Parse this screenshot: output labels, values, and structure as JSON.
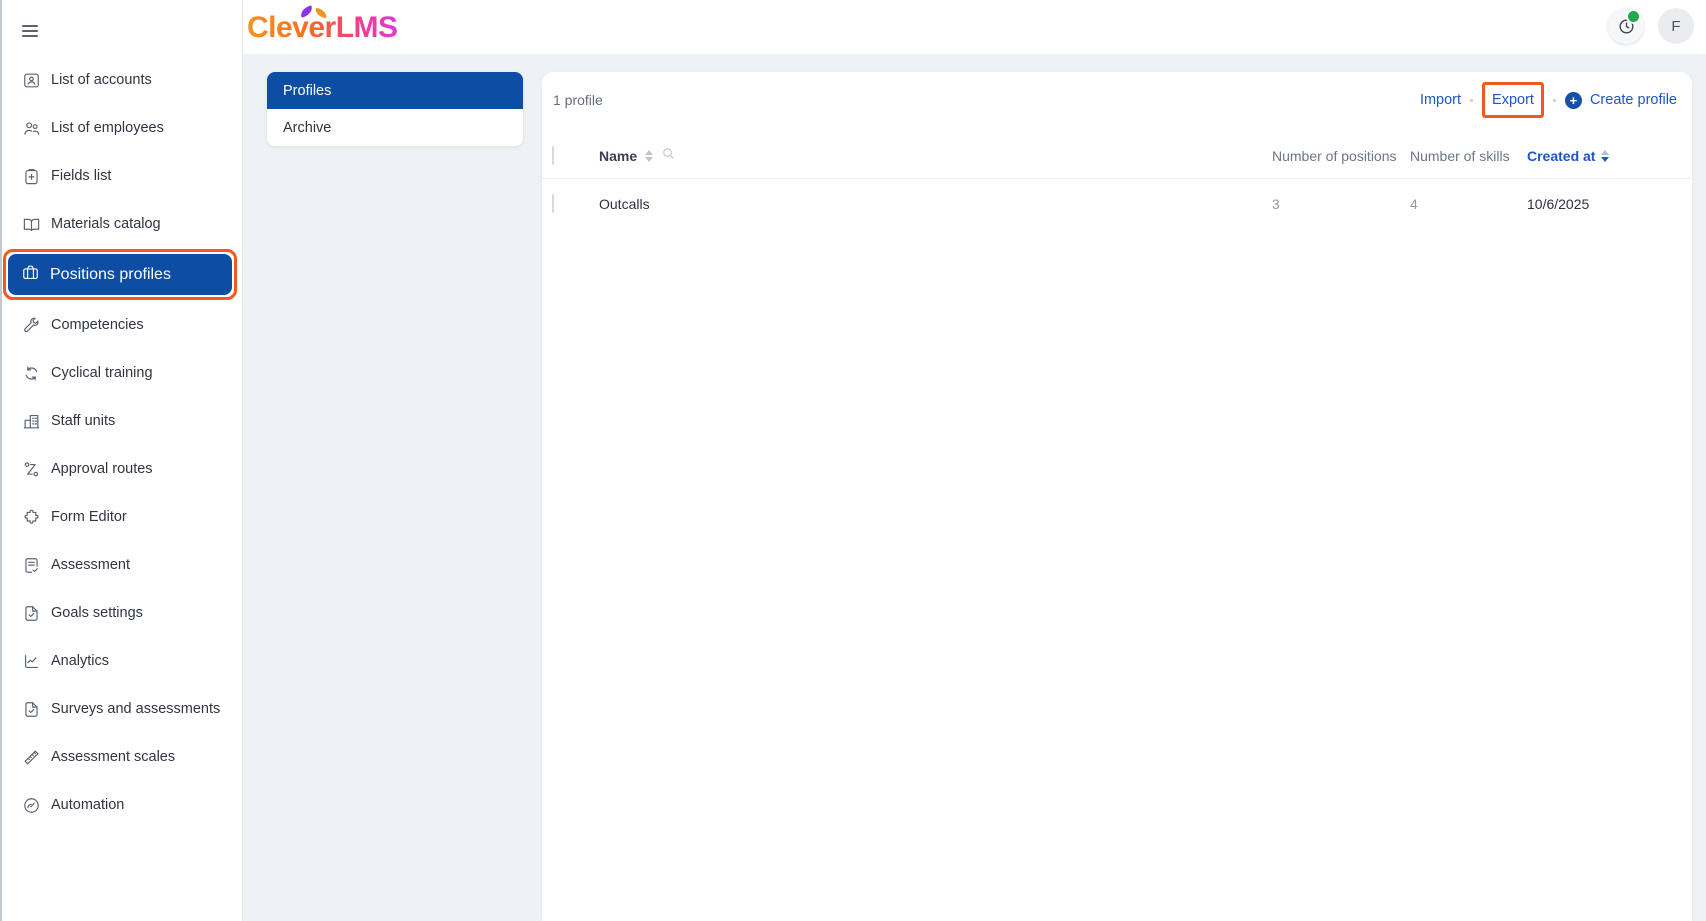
{
  "header": {
    "logo_text": "CleverLMS",
    "avatar_initial": "F"
  },
  "sidebar": {
    "items": [
      {
        "label": "List of accounts",
        "icon": "account-card-icon"
      },
      {
        "label": "List of employees",
        "icon": "people-icon"
      },
      {
        "label": "Fields list",
        "icon": "clipboard-plus-icon"
      },
      {
        "label": "Materials catalog",
        "icon": "open-book-icon"
      },
      {
        "label": "Positions profiles",
        "icon": "briefcase-icon",
        "selected": true,
        "highlighted": true
      },
      {
        "label": "Competencies",
        "icon": "wrench-icon"
      },
      {
        "label": "Cyclical training",
        "icon": "refresh-icon"
      },
      {
        "label": "Staff units",
        "icon": "building-icon"
      },
      {
        "label": "Approval routes",
        "icon": "route-nodes-icon"
      },
      {
        "label": "Form Editor",
        "icon": "puzzle-icon"
      },
      {
        "label": "Assessment",
        "icon": "document-check-icon"
      },
      {
        "label": "Goals settings",
        "icon": "file-check-icon"
      },
      {
        "label": "Analytics",
        "icon": "line-chart-icon"
      },
      {
        "label": "Surveys and assessments",
        "icon": "file-check-icon"
      },
      {
        "label": "Assessment scales",
        "icon": "ruler-icon"
      },
      {
        "label": "Automation",
        "icon": "gauge-icon"
      }
    ]
  },
  "subnav": {
    "tabs": [
      {
        "label": "Profiles",
        "active": true
      },
      {
        "label": "Archive",
        "active": false
      }
    ]
  },
  "toolbar": {
    "count_label": "1 profile",
    "import_label": "Import",
    "export_label": "Export",
    "create_label": "Create profile"
  },
  "table": {
    "columns": {
      "name": "Name",
      "positions": "Number of positions",
      "skills": "Number of skills",
      "created": "Created at"
    },
    "rows": [
      {
        "name": "Outcalls",
        "positions": "3",
        "skills": "4",
        "created": "10/6/2025"
      }
    ]
  },
  "colors": {
    "primary_blue": "#0d4da3",
    "link_blue": "#1d56c4",
    "highlight_orange": "#f2591f",
    "badge_green": "#1fa94f",
    "logo_orange": "#f6921e",
    "logo_magenta": "#d83fd2"
  }
}
